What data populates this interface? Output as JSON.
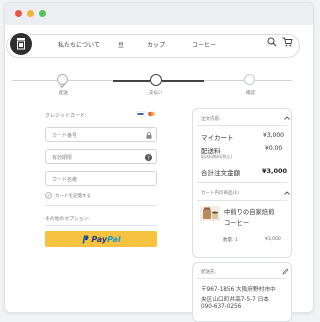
{
  "nav": {
    "items": [
      "私たちについて",
      "豆",
      "カップ",
      "コーヒー"
    ]
  },
  "steps": [
    {
      "label": "配送",
      "state": "done"
    },
    {
      "label": "支払い",
      "state": "active"
    },
    {
      "label": "確認",
      "state": "todo"
    }
  ],
  "payment": {
    "credit_card_label": "クレジットカード:",
    "card_number_placeholder": "カード番号",
    "expiry_placeholder": "有効期限",
    "card_name_placeholder": "カード名義",
    "remember_card_label": "カードを記憶する",
    "other_options_label": "その他のオプション:",
    "paypal_part1": "Pay",
    "paypal_part2": "Pal"
  },
  "order": {
    "title": "注文内容:",
    "my_cart_label": "マイカート",
    "my_cart_value": "¥3,000",
    "shipping_label": "配送料",
    "shipping_value": "¥0.00",
    "shipping_note": "配送料無料(税込)",
    "total_label": "合計注文金額",
    "total_value": "¥3,000"
  },
  "cart": {
    "title": "カート内の商品(1)",
    "item_name_line1": "中煎りの自家焙煎",
    "item_name_line2": "コーヒー",
    "quantity_label": "数量: 1",
    "item_price": "¥3,000"
  },
  "delivery": {
    "title": "配送先:",
    "address_line1": "〒967-1856 大阪府野村市中",
    "address_line2": "央区山口町井高7-5-7 日本",
    "phone": "090-637-0256"
  },
  "colors": {
    "accent_dark": "#333333",
    "paypal_yellow": "#f7c240",
    "paypal_dark_blue": "#253b80",
    "paypal_light_blue": "#179bd7"
  }
}
